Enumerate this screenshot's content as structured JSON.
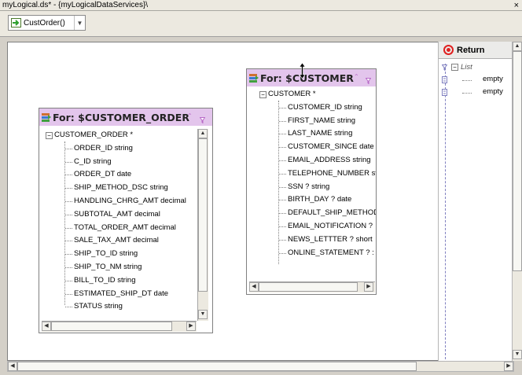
{
  "window": {
    "title": "myLogical.ds* - {myLogicalDataServices}\\",
    "close_glyph": "×"
  },
  "toolbar": {
    "function_selector": {
      "value": "CustOrder()",
      "icon": "function-arrow-icon",
      "dropdown_glyph": "▼"
    }
  },
  "accent_colors": {
    "node_header_bg": "#e3c5ec",
    "return_icon": "#e02020"
  },
  "nodes": {
    "customer_order": {
      "title": "For: $CUSTOMER_ORDER",
      "root": "CUSTOMER_ORDER *",
      "fields": [
        "ORDER_ID string",
        "C_ID string",
        "ORDER_DT date",
        "SHIP_METHOD_DSC string",
        "HANDLING_CHRG_AMT decimal",
        "SUBTOTAL_AMT decimal",
        "TOTAL_ORDER_AMT decimal",
        "SALE_TAX_AMT decimal",
        "SHIP_TO_ID string",
        "SHIP_TO_NM string",
        "BILL_TO_ID string",
        "ESTIMATED_SHIP_DT date",
        "STATUS string"
      ]
    },
    "customer": {
      "title": "For: $CUSTOMER",
      "root": "CUSTOMER *",
      "fields": [
        "CUSTOMER_ID string",
        "FIRST_NAME string",
        "LAST_NAME string",
        "CUSTOMER_SINCE date",
        "EMAIL_ADDRESS string",
        "TELEPHONE_NUMBER st",
        "SSN ? string",
        "BIRTH_DAY ? date",
        "DEFAULT_SHIP_METHOD",
        "EMAIL_NOTIFICATION ?",
        "NEWS_LETTTER ? short",
        "ONLINE_STATEMENT ? :"
      ]
    }
  },
  "return_pane": {
    "title": "Return",
    "list_label": "List",
    "items": [
      "empty",
      "empty"
    ]
  },
  "glyphs": {
    "collapse": "⌃",
    "expand_minus": "−",
    "arrow_left": "◀",
    "arrow_right": "▶",
    "arrow_up": "▲",
    "arrow_down": "▼"
  }
}
